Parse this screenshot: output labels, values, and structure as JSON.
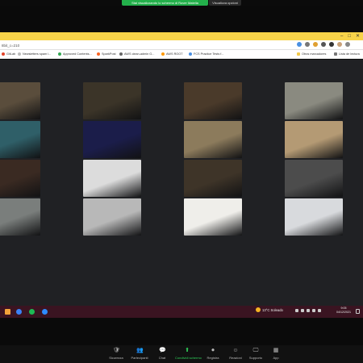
{
  "zoom_share": {
    "banner": "Stai visualizzando lo schermo di Rover Matella",
    "options": "Visualizza opzioni"
  },
  "browser": {
    "url_fragment": "8bit_c=210",
    "bookmarks": [
      {
        "label": "GitLab",
        "color": "#e24329"
      },
      {
        "label": "Newsletters spam l...",
        "color": "#bbbbbb"
      },
      {
        "label": "Approved Contents...",
        "color": "#34a853"
      },
      {
        "label": "SparkPost",
        "color": "#fa6423"
      },
      {
        "label": "AWS clean-admin G...",
        "color": "#666666"
      },
      {
        "label": "AWS ROOT",
        "color": "#ff9900"
      },
      {
        "label": "FCS Practice Tests f...",
        "color": "#4a90e2"
      }
    ],
    "bookmarks_right": [
      {
        "label": "Otros marcadores",
        "color": "#f2c94c"
      },
      {
        "label": "Lista de lectura",
        "color": "#777777"
      }
    ],
    "extension_colors": [
      "#4a90e2",
      "#777777",
      "#e0a030",
      "#555555",
      "#333333",
      "#c9a27a",
      "#888888"
    ]
  },
  "gallery": {
    "columns": 4,
    "rows": 4,
    "photos": [
      {
        "name": "elderly-couple-photo",
        "color": "#5a4d3c"
      },
      {
        "name": "group-portrait-photo",
        "color": "#3b3428"
      },
      {
        "name": "man-with-bread-photo",
        "color": "#4a3a2a"
      },
      {
        "name": "cyclists-road-photo",
        "color": "#8a8a80"
      },
      {
        "name": "train-window-photo",
        "color": "#2f5f68"
      },
      {
        "name": "night-lights-photo",
        "color": "#1b1d4a"
      },
      {
        "name": "misty-valley-photo",
        "color": "#8c7b5c"
      },
      {
        "name": "sandy-path-photo",
        "color": "#b49a74"
      },
      {
        "name": "fire-figure-photo",
        "color": "#3a2a22"
      },
      {
        "name": "dancer-photo",
        "color": "#dcdcdc"
      },
      {
        "name": "workshop-man-photo",
        "color": "#3e3428"
      },
      {
        "name": "curved-walls-photo",
        "color": "#4c4c4c"
      },
      {
        "name": "tree-lined-road-photo",
        "color": "#7a7e7c"
      },
      {
        "name": "snowy-house-photo",
        "color": "#b8b8b8"
      },
      {
        "name": "fox-in-snow-photo",
        "color": "#efeeea"
      },
      {
        "name": "owl-photo",
        "color": "#d8dadd"
      }
    ]
  },
  "taskbar": {
    "app_icons": [
      {
        "name": "windows-start-icon",
        "color": "#f2a33a"
      },
      {
        "name": "chrome-icon",
        "color": "#3b82f6"
      },
      {
        "name": "spotify-icon",
        "color": "#1db954"
      },
      {
        "name": "zoom-icon",
        "color": "#2d8cff"
      }
    ],
    "weather": "13°C  Soleado",
    "time": "9:05",
    "date": "04/12/2021"
  },
  "zoom_controls": [
    {
      "label": "Sicurezza",
      "icon": "🛡"
    },
    {
      "label": "Partecipanti",
      "icon": "👥"
    },
    {
      "label": "Chat",
      "icon": "💬"
    },
    {
      "label": "Condividi schermo",
      "icon": "⬆"
    },
    {
      "label": "Registra",
      "icon": "⏺"
    },
    {
      "label": "Reazioni",
      "icon": "☺"
    },
    {
      "label": "Supporto",
      "icon": "🖵"
    },
    {
      "label": "App",
      "icon": "▦"
    }
  ]
}
